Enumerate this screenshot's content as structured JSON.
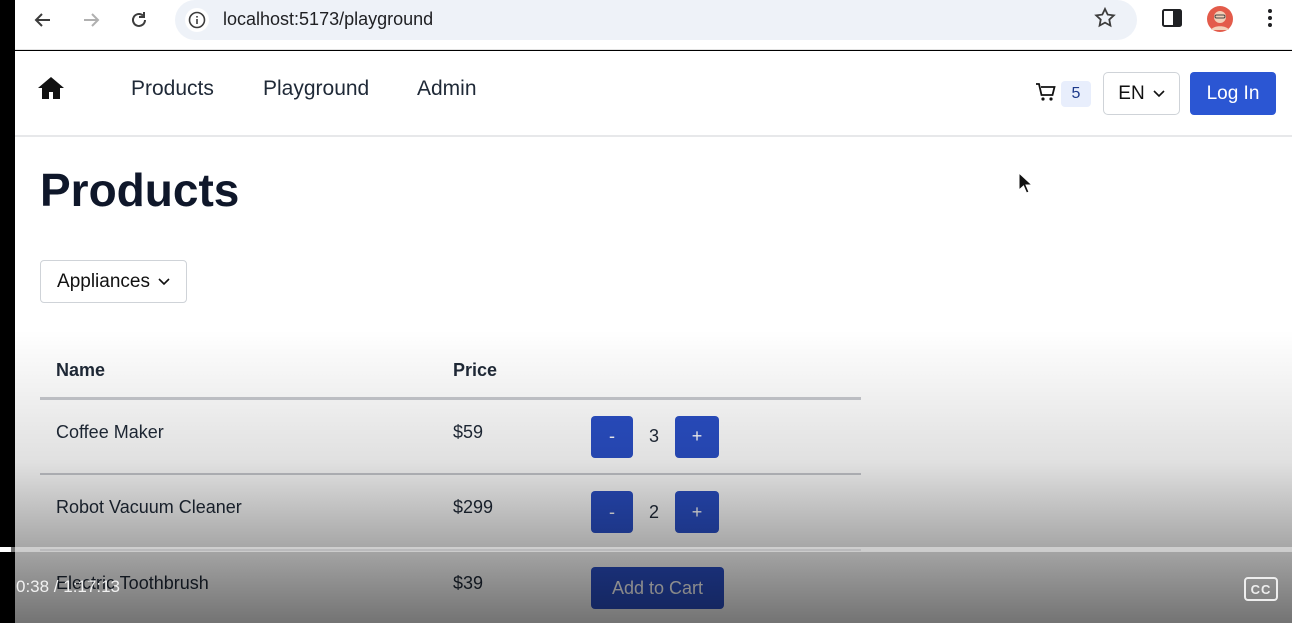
{
  "browser": {
    "url": "localhost:5173/playground"
  },
  "header": {
    "nav": [
      "Products",
      "Playground",
      "Admin"
    ],
    "cart_count": "5",
    "language": "EN",
    "login_label": "Log In"
  },
  "main": {
    "title": "Products",
    "category_selected": "Appliances",
    "columns": [
      "Name",
      "Price"
    ],
    "rows": [
      {
        "name": "Coffee Maker",
        "price": "$59",
        "quantity": "3"
      },
      {
        "name": "Robot Vacuum Cleaner",
        "price": "$299",
        "quantity": "2"
      },
      {
        "name": "Electric Toothbrush",
        "price": "$39",
        "action": "Add to Cart"
      }
    ],
    "minus_label": "-",
    "plus_label": "+"
  },
  "video": {
    "time": "0:38 / 1:17:13",
    "cc_label": "CC",
    "progress": 0.0082
  },
  "colors": {
    "primary": "#2a4fc6",
    "login": "#2b56d3"
  }
}
